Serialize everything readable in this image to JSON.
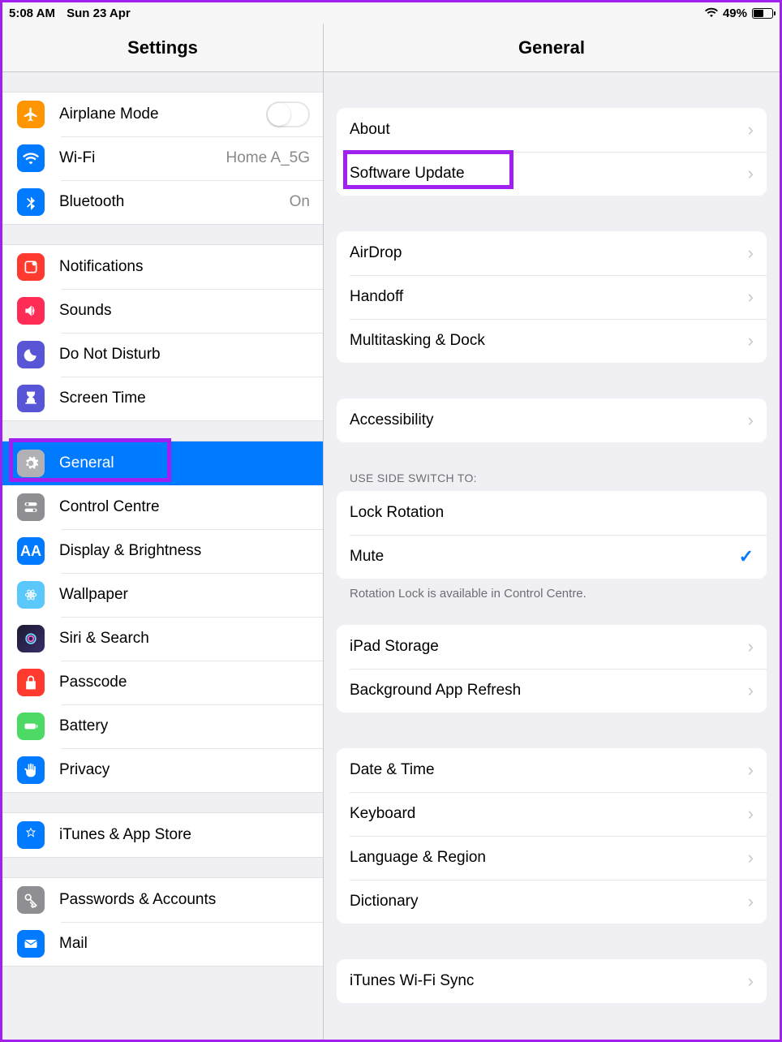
{
  "statusbar": {
    "time": "5:08 AM",
    "date": "Sun 23 Apr",
    "battery": "49%"
  },
  "sidebar": {
    "title": "Settings",
    "rows": {
      "airplane": "Airplane Mode",
      "wifi": {
        "label": "Wi-Fi",
        "value": "Home A_5G"
      },
      "bluetooth": {
        "label": "Bluetooth",
        "value": "On"
      },
      "notifications": "Notifications",
      "sounds": "Sounds",
      "dnd": "Do Not Disturb",
      "screentime": "Screen Time",
      "general": "General",
      "controlcentre": "Control Centre",
      "display": "Display & Brightness",
      "wallpaper": "Wallpaper",
      "siri": "Siri & Search",
      "passcode": "Passcode",
      "battery": "Battery",
      "privacy": "Privacy",
      "itunes": "iTunes & App Store",
      "passwords": "Passwords & Accounts",
      "mail": "Mail"
    }
  },
  "detail": {
    "title": "General",
    "groups": {
      "g1": [
        "About",
        "Software Update"
      ],
      "g2": [
        "AirDrop",
        "Handoff",
        "Multitasking & Dock"
      ],
      "g3": [
        "Accessibility"
      ],
      "sideSwitch": {
        "header": "USE SIDE SWITCH TO:",
        "opt1": "Lock Rotation",
        "opt2": "Mute",
        "footer": "Rotation Lock is available in Control Centre."
      },
      "g5": [
        "iPad Storage",
        "Background App Refresh"
      ],
      "g6": [
        "Date & Time",
        "Keyboard",
        "Language & Region",
        "Dictionary"
      ],
      "g7": [
        "iTunes Wi-Fi Sync"
      ]
    }
  }
}
